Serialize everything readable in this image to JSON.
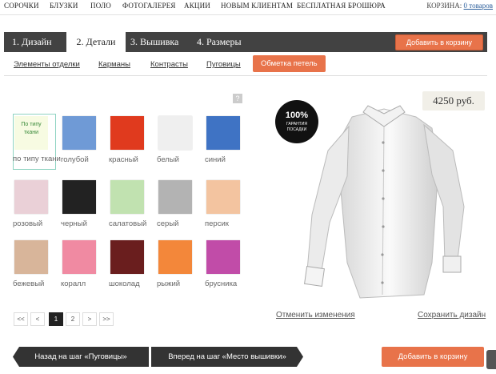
{
  "top_nav": [
    "СОРОЧКИ",
    "БЛУЗКИ",
    "ПОЛО",
    "ФОТОГАЛЕРЕЯ",
    "АКЦИИ",
    "НОВЫМ КЛИЕНТАМ",
    "БЕСПЛАТНАЯ БРОШЮРА"
  ],
  "cart": {
    "label": "КОРЗИНА:",
    "link": "0 товаров"
  },
  "steps": [
    "1. Дизайн",
    "2. Детали",
    "3. Вышивка",
    "4. Размеры"
  ],
  "add_to_cart_top": "Добавить в корзину",
  "subtabs": [
    "Элементы отделки",
    "Карманы",
    "Контрасты",
    "Пуговицы",
    "Обметка петель"
  ],
  "help": "?",
  "selected_swatch": {
    "chip_text": "По типу ткани",
    "label": "по типу ткани"
  },
  "swatches": [
    {
      "label": "голубой",
      "color": "#6f9ad6"
    },
    {
      "label": "красный",
      "color": "#e03a1e"
    },
    {
      "label": "белый",
      "color": "#efefef"
    },
    {
      "label": "синий",
      "color": "#3f73c4"
    },
    {
      "label": "розовый",
      "color": "#ead0d7"
    },
    {
      "label": "черный",
      "color": "#222222"
    },
    {
      "label": "салатовый",
      "color": "#c1e2b0"
    },
    {
      "label": "серый",
      "color": "#b3b3b3"
    },
    {
      "label": "персик",
      "color": "#f3c4a0"
    },
    {
      "label": "бежевый",
      "color": "#d8b59a"
    },
    {
      "label": "коралл",
      "color": "#f08aa2"
    },
    {
      "label": "шоколад",
      "color": "#6a1e1e"
    },
    {
      "label": "рыжий",
      "color": "#f3873a"
    },
    {
      "label": "брусника",
      "color": "#c14ca8"
    }
  ],
  "pagination": [
    "<<",
    "<",
    "1",
    "2",
    ">",
    ">>"
  ],
  "price": "4250 руб.",
  "badge": {
    "big": "100%",
    "small1": "ГАРАНТИЯ",
    "small2": "ПОСАДКИ"
  },
  "cancel": "Отменить изменения",
  "save": "Сохранить дизайн",
  "back": "Назад на шаг «Пуговицы»",
  "forward": "Вперед на шаг «Место вышивки»",
  "add_to_cart_bottom": "Добавить в корзину"
}
